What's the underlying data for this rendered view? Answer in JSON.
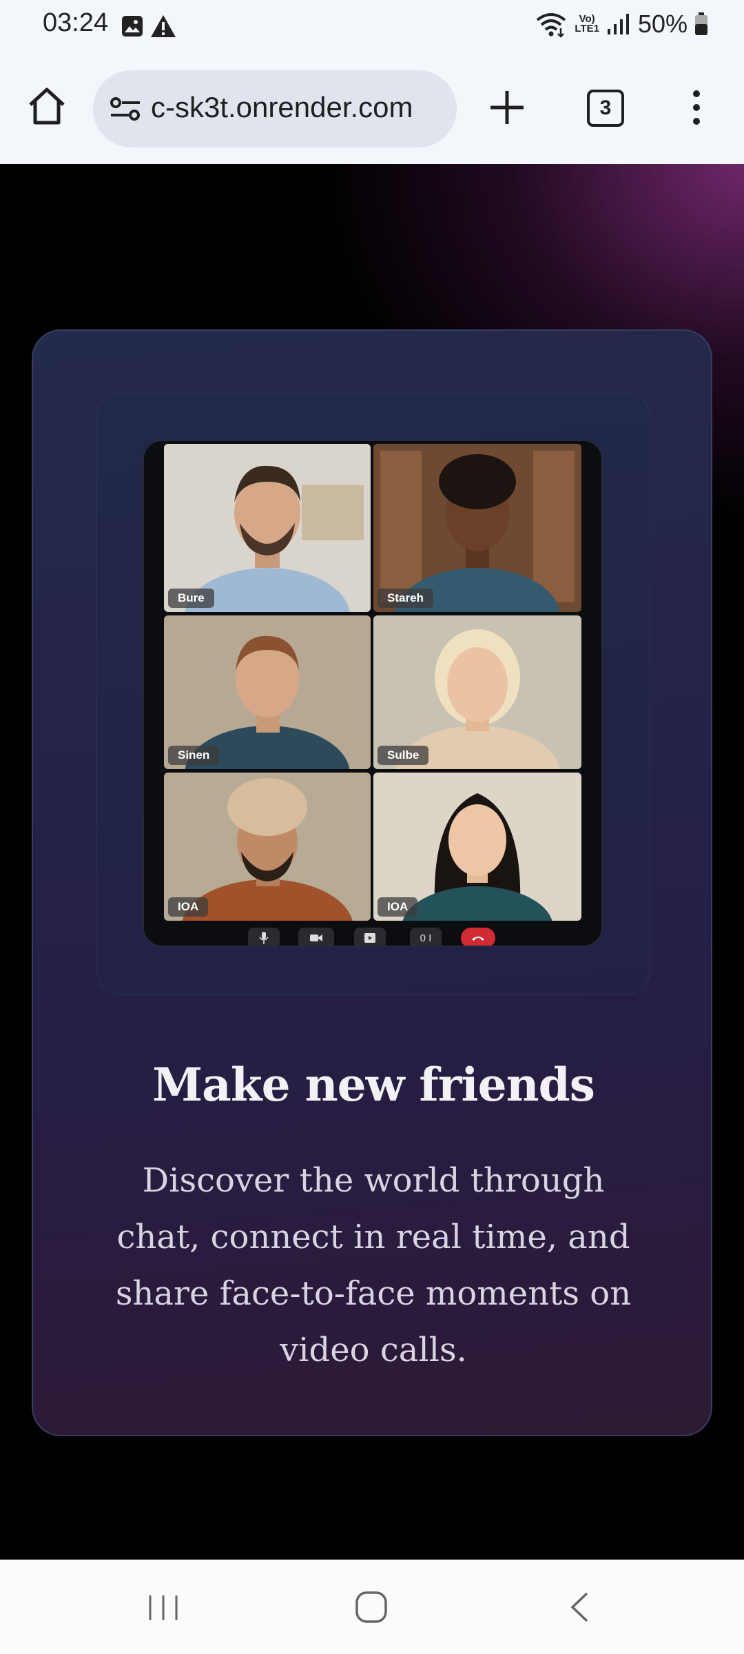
{
  "status_bar": {
    "time": "03:24",
    "volte_top": "Vo)",
    "volte_bottom": "LTE1",
    "battery_text": "50%",
    "icons": [
      "image-icon",
      "warning-icon",
      "wifi-icon",
      "signal-icon",
      "battery-icon"
    ]
  },
  "browser": {
    "url": "c-sk3t.onrender.com",
    "tab_count": "3",
    "icons": [
      "home-icon",
      "site-settings-icon",
      "new-tab-icon",
      "tabs-icon",
      "menu-icon"
    ]
  },
  "video_call": {
    "participants": [
      {
        "name": "Bure"
      },
      {
        "name": "Stareh"
      },
      {
        "name": "Sinen"
      },
      {
        "name": "Sulbe"
      },
      {
        "name": "IOA"
      },
      {
        "name": "IOA"
      }
    ],
    "timer_text": "0 I",
    "controls": [
      "mic-icon",
      "camera-icon",
      "screen-share-icon",
      "timer",
      "end-call-icon"
    ]
  },
  "hero": {
    "title": "Make new friends",
    "description": "Discover the world through chat, connect in real time, and share face-to-face moments on video calls."
  },
  "colors": {
    "card_bg": "#242a4b",
    "accent_glow": "#822d7d",
    "end_call": "#d12a33"
  }
}
